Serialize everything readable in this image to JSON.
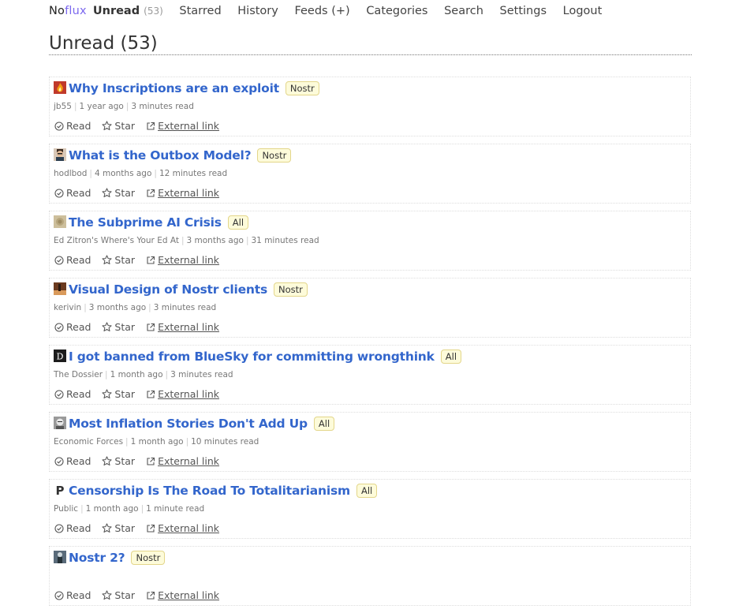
{
  "app": {
    "logo_no": "No",
    "logo_flux": "flux"
  },
  "nav": {
    "unread_label": "Unread",
    "unread_count": "(53)",
    "starred": "Starred",
    "history": "History",
    "feeds": "Feeds (+)",
    "categories": "Categories",
    "search": "Search",
    "settings": "Settings",
    "logout": "Logout"
  },
  "page": {
    "title": "Unread (53)"
  },
  "actions": {
    "read": "Read",
    "star": "Star",
    "external": "External link"
  },
  "entries": [
    {
      "title": "Why Inscriptions are an exploit",
      "category": "Nostr",
      "author": "jb55",
      "date": "1 year ago",
      "reading": "3 minutes read",
      "thumb": "flame"
    },
    {
      "title": "What is the Outbox Model?",
      "category": "Nostr",
      "author": "hodlbod",
      "date": "4 months ago",
      "reading": "12 minutes read",
      "thumb": "face"
    },
    {
      "title": "The Subprime AI Crisis",
      "category": "All",
      "author": "Ed Zitron's Where's Your Ed At",
      "date": "3 months ago",
      "reading": "31 minutes read",
      "thumb": "tan"
    },
    {
      "title": "Visual Design of Nostr clients",
      "category": "Nostr",
      "author": "kerivin",
      "date": "3 months ago",
      "reading": "3 minutes read",
      "thumb": "brown"
    },
    {
      "title": "I got banned from BlueSky for committing wrongthink",
      "category": "All",
      "author": "The Dossier",
      "date": "1 month ago",
      "reading": "3 minutes read",
      "thumb": "d-letter"
    },
    {
      "title": "Most Inflation Stories Don't Add Up",
      "category": "All",
      "author": "Economic Forces",
      "date": "1 month ago",
      "reading": "10 minutes read",
      "thumb": "portrait"
    },
    {
      "title": "Censorship Is The Road To Totalitarianism",
      "category": "All",
      "author": "Public",
      "date": "1 month ago",
      "reading": "1 minute read",
      "thumb": "p-letter"
    },
    {
      "title": "Nostr 2?",
      "category": "Nostr",
      "author": "",
      "date": "",
      "reading": "",
      "thumb": "figure"
    }
  ]
}
